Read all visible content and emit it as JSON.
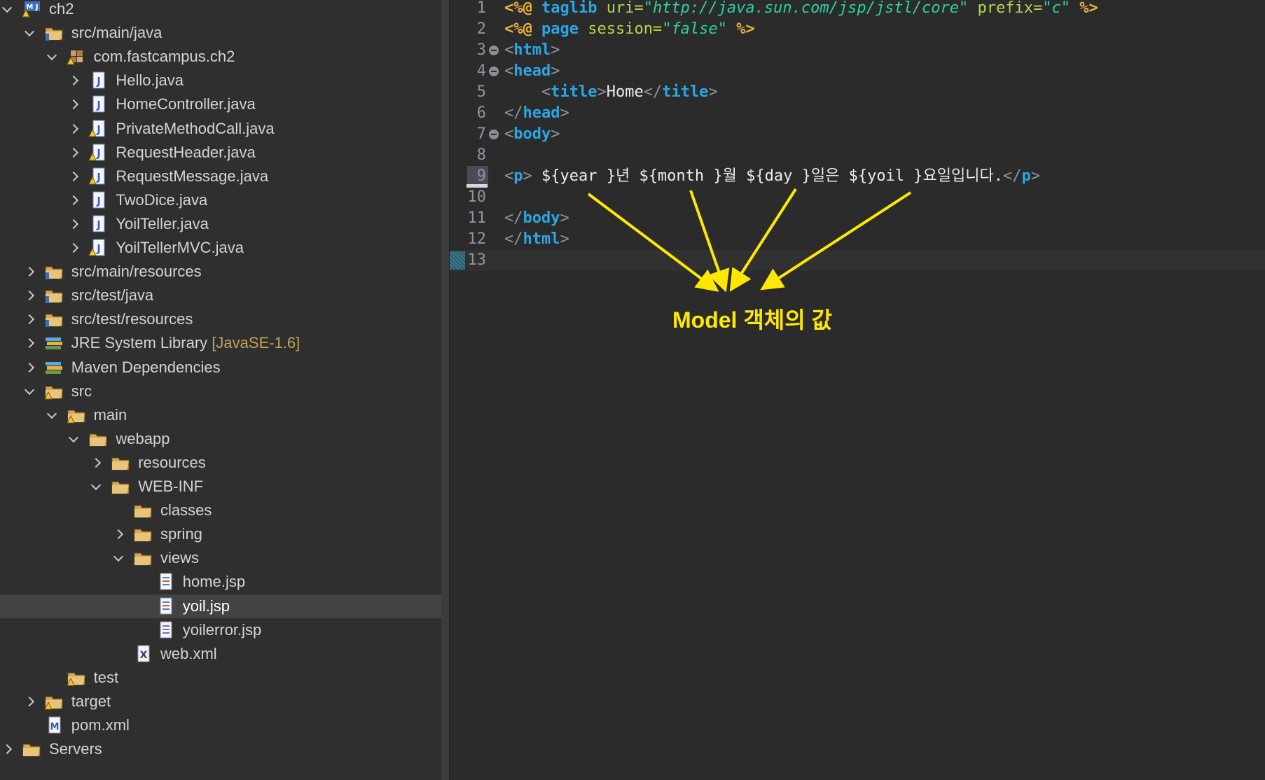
{
  "explorer": {
    "items": [
      {
        "label": "ch2",
        "icon": "maven-project-icon",
        "chevron": "open"
      },
      {
        "label": "src/main/java",
        "icon": "source-folder-icon",
        "chevron": "open"
      },
      {
        "label": "com.fastcampus.ch2",
        "icon": "package-icon",
        "chevron": "open"
      },
      {
        "label": "Hello.java",
        "icon": "java-file-icon",
        "chevron": "closed"
      },
      {
        "label": "HomeController.java",
        "icon": "java-file-icon",
        "chevron": "closed"
      },
      {
        "label": "PrivateMethodCall.java",
        "icon": "java-file-warning-icon",
        "chevron": "closed"
      },
      {
        "label": "RequestHeader.java",
        "icon": "java-file-warning-icon",
        "chevron": "closed"
      },
      {
        "label": "RequestMessage.java",
        "icon": "java-file-warning-icon",
        "chevron": "closed"
      },
      {
        "label": "TwoDice.java",
        "icon": "java-file-icon",
        "chevron": "closed"
      },
      {
        "label": "YoilTeller.java",
        "icon": "java-file-icon",
        "chevron": "closed"
      },
      {
        "label": "YoilTellerMVC.java",
        "icon": "java-file-warning-icon",
        "chevron": "closed"
      },
      {
        "label": "src/main/resources",
        "icon": "source-folder-icon",
        "chevron": "closed"
      },
      {
        "label": "src/test/java",
        "icon": "source-folder-icon",
        "chevron": "closed"
      },
      {
        "label": "src/test/resources",
        "icon": "source-folder-icon",
        "chevron": "closed"
      },
      {
        "label": "JRE System Library",
        "decoration": "[JavaSE-1.6]",
        "icon": "library-icon",
        "chevron": "closed"
      },
      {
        "label": "Maven Dependencies",
        "icon": "library-icon",
        "chevron": "closed"
      },
      {
        "label": "src",
        "icon": "folder-warning-icon",
        "chevron": "open"
      },
      {
        "label": "main",
        "icon": "folder-warning-icon",
        "chevron": "open"
      },
      {
        "label": "webapp",
        "icon": "folder-icon",
        "chevron": "open"
      },
      {
        "label": "resources",
        "icon": "folder-icon",
        "chevron": "closed"
      },
      {
        "label": "WEB-INF",
        "icon": "folder-icon",
        "chevron": "open"
      },
      {
        "label": "classes",
        "icon": "folder-icon",
        "chevron": "none"
      },
      {
        "label": "spring",
        "icon": "folder-icon",
        "chevron": "closed"
      },
      {
        "label": "views",
        "icon": "folder-icon",
        "chevron": "open"
      },
      {
        "label": "home.jsp",
        "icon": "jsp-file-icon",
        "chevron": "none"
      },
      {
        "label": "yoil.jsp",
        "icon": "jsp-file-icon",
        "chevron": "none",
        "selected": true
      },
      {
        "label": "yoilerror.jsp",
        "icon": "jsp-file-icon",
        "chevron": "none"
      },
      {
        "label": "web.xml",
        "icon": "xml-file-icon",
        "chevron": "none"
      },
      {
        "label": "test",
        "icon": "folder-warning-icon",
        "chevron": "none"
      },
      {
        "label": "target",
        "icon": "folder-warning-icon",
        "chevron": "closed"
      },
      {
        "label": "pom.xml",
        "icon": "maven-pom-icon",
        "chevron": "none"
      },
      {
        "label": "Servers",
        "icon": "folder-icon",
        "chevron": "closed"
      }
    ]
  },
  "editor": {
    "lines": [
      {
        "num": "1",
        "tokens": [
          [
            "dir",
            "<%@ "
          ],
          [
            "kw",
            "taglib "
          ],
          [
            "attr",
            "uri="
          ],
          [
            "strq",
            "\""
          ],
          [
            "str",
            "http://java.sun.com/jsp/jstl/core"
          ],
          [
            "strq",
            "\" "
          ],
          [
            "attr",
            "prefix="
          ],
          [
            "strq",
            "\""
          ],
          [
            "str",
            "c"
          ],
          [
            "strq",
            "\" "
          ],
          [
            "dir",
            "%>"
          ]
        ]
      },
      {
        "num": "2",
        "tokens": [
          [
            "dir",
            "<%@ "
          ],
          [
            "kw",
            "page "
          ],
          [
            "attr",
            "session="
          ],
          [
            "strq",
            "\""
          ],
          [
            "str",
            "false"
          ],
          [
            "strq",
            "\" "
          ],
          [
            "dir",
            "%>"
          ]
        ]
      },
      {
        "num": "3",
        "fold": true,
        "tokens": [
          [
            "punc",
            "<"
          ],
          [
            "kw",
            "html"
          ],
          [
            "punc",
            ">"
          ]
        ]
      },
      {
        "num": "4",
        "fold": true,
        "tokens": [
          [
            "punc",
            "<"
          ],
          [
            "kw",
            "head"
          ],
          [
            "punc",
            ">"
          ]
        ]
      },
      {
        "num": "5",
        "tokens": [
          [
            "txt",
            "    "
          ],
          [
            "punc",
            "<"
          ],
          [
            "kw",
            "title"
          ],
          [
            "punc",
            ">"
          ],
          [
            "txt",
            "Home"
          ],
          [
            "punc",
            "</"
          ],
          [
            "kw",
            "title"
          ],
          [
            "punc",
            ">"
          ]
        ]
      },
      {
        "num": "6",
        "tokens": [
          [
            "punc",
            "</"
          ],
          [
            "kw",
            "head"
          ],
          [
            "punc",
            ">"
          ]
        ]
      },
      {
        "num": "7",
        "fold": true,
        "tokens": [
          [
            "punc",
            "<"
          ],
          [
            "kw",
            "body"
          ],
          [
            "punc",
            ">"
          ]
        ]
      },
      {
        "num": "8",
        "tokens": []
      },
      {
        "num": "9",
        "marked": true,
        "tokens": [
          [
            "punc",
            "<"
          ],
          [
            "kw",
            "p"
          ],
          [
            "punc",
            "> "
          ],
          [
            "txt",
            "${year }년 ${month }월 ${day }일은 ${yoil }요일입니다."
          ],
          [
            "punc",
            "</"
          ],
          [
            "kw",
            "p"
          ],
          [
            "punc",
            ">"
          ]
        ]
      },
      {
        "num": "10",
        "underlined": true,
        "tokens": []
      },
      {
        "num": "11",
        "tokens": [
          [
            "punc",
            "</"
          ],
          [
            "kw",
            "body"
          ],
          [
            "punc",
            ">"
          ]
        ]
      },
      {
        "num": "12",
        "tokens": [
          [
            "punc",
            "</"
          ],
          [
            "kw",
            "html"
          ],
          [
            "punc",
            ">"
          ]
        ]
      },
      {
        "num": "13",
        "current": true,
        "tokens": []
      }
    ]
  },
  "annotation": {
    "text": "Model 객체의 값",
    "color": "#ffe800"
  }
}
